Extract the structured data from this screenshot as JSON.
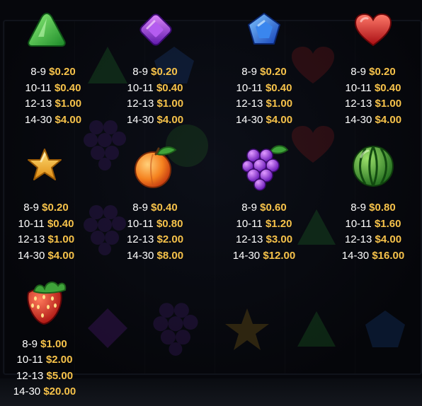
{
  "symbols": [
    {
      "icon": "green-triangle-gem-icon",
      "pays": [
        {
          "range": "8-9",
          "amount": "$0.20"
        },
        {
          "range": "10-11",
          "amount": "$0.40"
        },
        {
          "range": "12-13",
          "amount": "$1.00"
        },
        {
          "range": "14-30",
          "amount": "$4.00"
        }
      ]
    },
    {
      "icon": "purple-diamond-gem-icon",
      "pays": [
        {
          "range": "8-9",
          "amount": "$0.20"
        },
        {
          "range": "10-11",
          "amount": "$0.40"
        },
        {
          "range": "12-13",
          "amount": "$1.00"
        },
        {
          "range": "14-30",
          "amount": "$4.00"
        }
      ]
    },
    {
      "icon": "blue-pentagon-gem-icon",
      "pays": [
        {
          "range": "8-9",
          "amount": "$0.20"
        },
        {
          "range": "10-11",
          "amount": "$0.40"
        },
        {
          "range": "12-13",
          "amount": "$1.00"
        },
        {
          "range": "14-30",
          "amount": "$4.00"
        }
      ]
    },
    {
      "icon": "red-heart-gem-icon",
      "pays": [
        {
          "range": "8-9",
          "amount": "$0.20"
        },
        {
          "range": "10-11",
          "amount": "$0.40"
        },
        {
          "range": "12-13",
          "amount": "$1.00"
        },
        {
          "range": "14-30",
          "amount": "$4.00"
        }
      ]
    },
    {
      "icon": "star-icon",
      "pays": [
        {
          "range": "8-9",
          "amount": "$0.20"
        },
        {
          "range": "10-11",
          "amount": "$0.40"
        },
        {
          "range": "12-13",
          "amount": "$1.00"
        },
        {
          "range": "14-30",
          "amount": "$4.00"
        }
      ]
    },
    {
      "icon": "peach-icon",
      "pays": [
        {
          "range": "8-9",
          "amount": "$0.40"
        },
        {
          "range": "10-11",
          "amount": "$0.80"
        },
        {
          "range": "12-13",
          "amount": "$2.00"
        },
        {
          "range": "14-30",
          "amount": "$8.00"
        }
      ]
    },
    {
      "icon": "grapes-icon",
      "pays": [
        {
          "range": "8-9",
          "amount": "$0.60"
        },
        {
          "range": "10-11",
          "amount": "$1.20"
        },
        {
          "range": "12-13",
          "amount": "$3.00"
        },
        {
          "range": "14-30",
          "amount": "$12.00"
        }
      ]
    },
    {
      "icon": "watermelon-icon",
      "pays": [
        {
          "range": "8-9",
          "amount": "$0.80"
        },
        {
          "range": "10-11",
          "amount": "$1.60"
        },
        {
          "range": "12-13",
          "amount": "$4.00"
        },
        {
          "range": "14-30",
          "amount": "$16.00"
        }
      ]
    },
    {
      "icon": "strawberry-icon",
      "pays": [
        {
          "range": "8-9",
          "amount": "$1.00"
        },
        {
          "range": "10-11",
          "amount": "$2.00"
        },
        {
          "range": "12-13",
          "amount": "$5.00"
        },
        {
          "range": "14-30",
          "amount": "$20.00"
        }
      ]
    }
  ],
  "colors": {
    "amount": "#f6c24a",
    "range": "#ffffff",
    "background": "#06070c"
  }
}
